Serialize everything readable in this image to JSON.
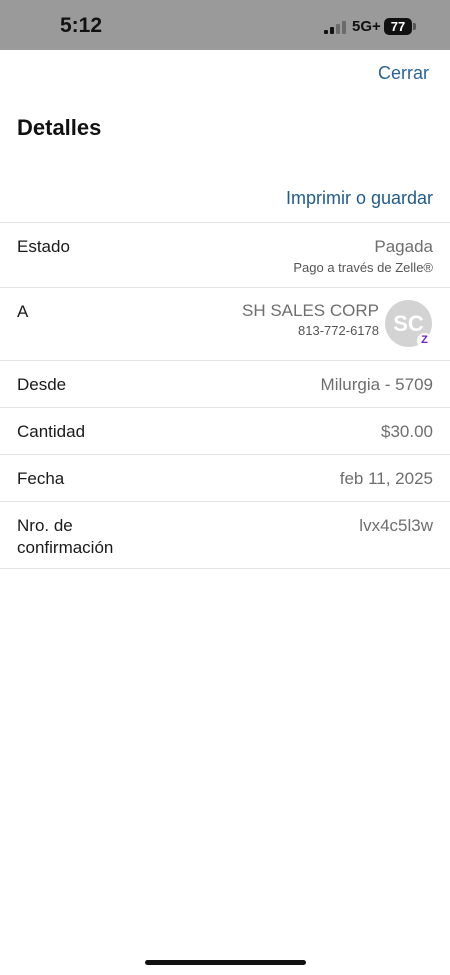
{
  "status_bar": {
    "time": "5:12",
    "network": "5G+",
    "battery": "77"
  },
  "header": {
    "close_label": "Cerrar",
    "title": "Detalles",
    "print_label": "Imprimir o guardar"
  },
  "details": {
    "estado": {
      "label": "Estado",
      "value": "Pagada",
      "sub": "Pago a través de Zelle®"
    },
    "recipient": {
      "label": "A",
      "name": "SH SALES CORP",
      "phone": "813-772-6178",
      "initials": "SC",
      "badge": "Z"
    },
    "desde": {
      "label": "Desde",
      "value": "Milurgia - 5709"
    },
    "cantidad": {
      "label": "Cantidad",
      "value": "$30.00"
    },
    "fecha": {
      "label": "Fecha",
      "value": "feb 11, 2025"
    },
    "confirmacion": {
      "label_line1": "Nro. de",
      "label_line2": "confirmación",
      "value": "lvx4c5l3w"
    }
  },
  "colors": {
    "link": "#1f5c8b",
    "status_bar": "#9a9a9a",
    "zelle_purple": "#6d1ed4"
  }
}
